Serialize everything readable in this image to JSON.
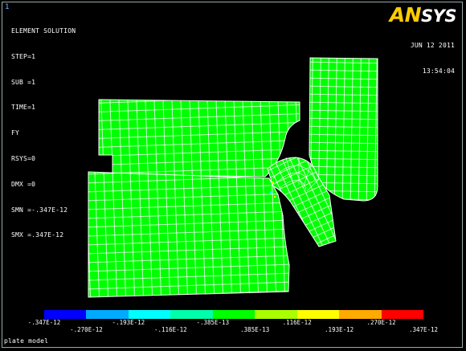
{
  "window_number": "1",
  "title": "ELEMENT SOLUTION",
  "info_lines": [
    "STEP=1",
    "SUB =1",
    "TIME=1",
    "FY",
    "RSYS=0",
    "DMX =0",
    "SMN =-.347E-12",
    "SMX =.347E-12"
  ],
  "logo": {
    "first": "AN",
    "second": "SYS",
    "name": "ANSYS"
  },
  "date": "JUN 12 2011",
  "time": "13:54:04",
  "legend": {
    "colors": [
      "#0000ff",
      "#00aaff",
      "#00ffff",
      "#00ffaa",
      "#00ff00",
      "#aaff00",
      "#ffff00",
      "#ffaa00",
      "#ff0000"
    ],
    "top_labels": [
      "-.347E-12",
      "-.193E-12",
      "-.385E-13",
      ".116E-12",
      ".270E-12"
    ],
    "bottom_labels": [
      "-.270E-12",
      "-.116E-12",
      ".385E-13",
      ".193E-12",
      ".347E-12"
    ]
  },
  "plot_title": "plate model",
  "colors": {
    "background": "#000000",
    "mesh_fill": "#00ff00",
    "mesh_lines": "#ffffff",
    "frame": "#99aaaa",
    "window_number": "#7fb3ff"
  }
}
